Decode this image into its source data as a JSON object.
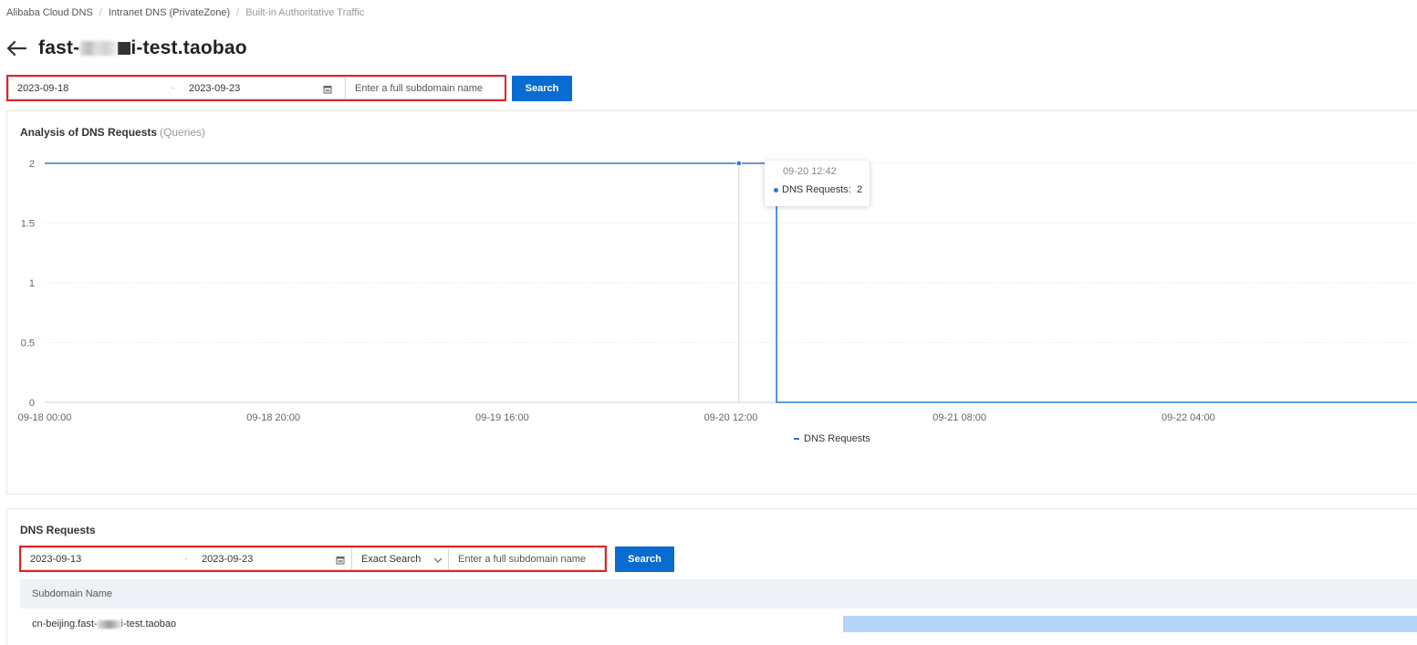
{
  "breadcrumb": {
    "item1": "Alibaba Cloud DNS",
    "item2": "Intranet DNS (PrivateZone)",
    "item3": "Built-in Authoritative Traffic"
  },
  "page": {
    "title_prefix": "fast-",
    "title_suffix": "i-test.taobao"
  },
  "top_filter": {
    "start_date": "2023-09-18",
    "end_date": "2023-09-23",
    "subdomain_placeholder": "Enter a full subdomain name",
    "search_label": "Search"
  },
  "chart_panel": {
    "title": "Analysis of DNS Requests",
    "subtitle": "(Queries)"
  },
  "chart_data": {
    "type": "line",
    "step": true,
    "title": "Analysis of DNS Requests",
    "subtitle": "(Queries)",
    "x_ticks": [
      "09-18 00:00",
      "09-18 20:00",
      "09-19 16:00",
      "09-20 12:00",
      "09-21 08:00",
      "09-22 04:00"
    ],
    "y_ticks": [
      "0",
      "0.5",
      "1",
      "1.5",
      "2"
    ],
    "ylim": [
      0,
      2
    ],
    "xlim": [
      "2023-09-18 00:00",
      "2023-09-23 00:00"
    ],
    "grid": true,
    "legend_position": "bottom-center",
    "series": [
      {
        "name": "DNS Requests",
        "color": "#2a7ad6",
        "points": [
          {
            "x": "2023-09-18 00:00",
            "y": 2
          },
          {
            "x": "2023-09-20 12:42",
            "y": 2
          },
          {
            "x": "2023-09-20 16:00",
            "y": 2
          },
          {
            "x": "2023-09-20 16:00",
            "y": 0
          },
          {
            "x": "2023-09-23 00:00",
            "y": 0
          }
        ]
      }
    ],
    "tooltip": {
      "time": "09-20 12:42",
      "series_label": "DNS Requests:",
      "value": "2"
    }
  },
  "requests_panel": {
    "title": "DNS Requests",
    "start_date": "2023-09-13",
    "end_date": "2023-09-23",
    "match_mode": "Exact Search",
    "subdomain_placeholder": "Enter a full subdomain name",
    "search_label": "Search"
  },
  "table": {
    "columns": [
      "Subdomain Name"
    ],
    "rows": [
      {
        "subdomain_prefix": "cn-beijing.fast-",
        "subdomain_suffix": "i-test.taobao",
        "share": 1.0
      }
    ]
  }
}
